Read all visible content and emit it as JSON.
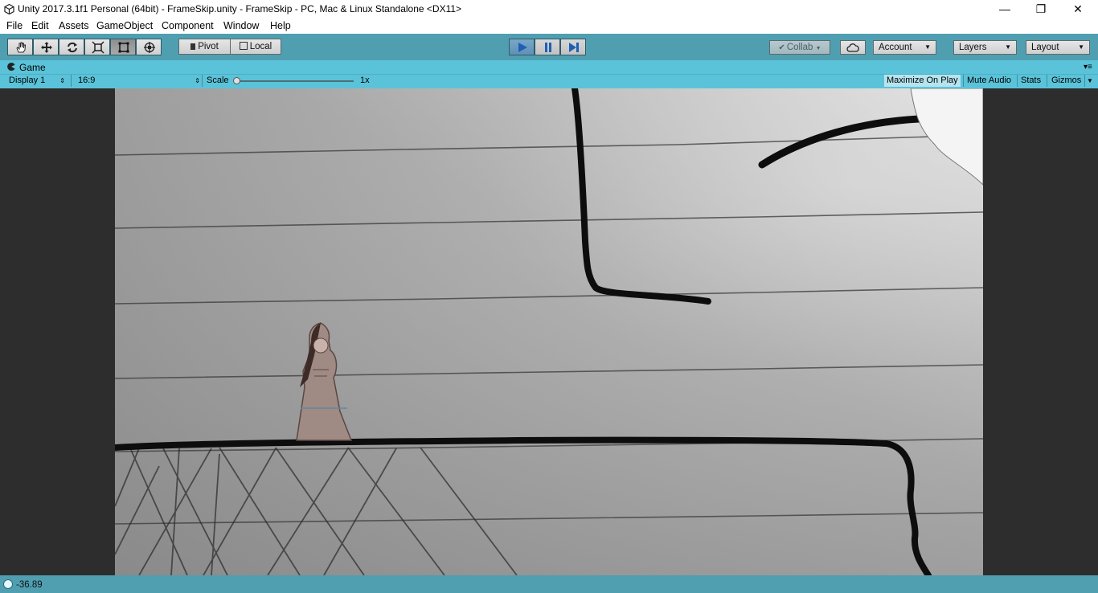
{
  "window": {
    "title": "Unity 2017.3.1f1 Personal (64bit) - FrameSkip.unity - FrameSkip - PC, Mac & Linux Standalone <DX11>",
    "minimize_glyph": "—",
    "maximize_glyph": "❐",
    "close_glyph": "✕"
  },
  "menu": {
    "items": [
      "File",
      "Edit",
      "Assets",
      "GameObject",
      "Component",
      "Window",
      "Help"
    ]
  },
  "toolbar": {
    "tools": [
      "hand-icon",
      "move-icon",
      "rotate-icon",
      "scale-icon",
      "rect-icon",
      "transform-icon"
    ],
    "active_tool": "rect-icon",
    "pivot_label": "Pivot",
    "local_label": "Local",
    "play_active": true,
    "collab_label": "Collab",
    "account_label": "Account",
    "layers_label": "Layers",
    "layout_label": "Layout",
    "dropdown_arrow": "▼"
  },
  "game_tab": {
    "label": "Game"
  },
  "game_bar": {
    "display_label": "Display 1",
    "aspect_label": "16:9",
    "scale_label": "Scale",
    "scale_value": "1x",
    "maximize_on_play": "Maximize On Play",
    "maximize_on_play_enabled": true,
    "mute_audio": "Mute Audio",
    "stats": "Stats",
    "gizmos": "Gizmos"
  },
  "status": {
    "text": "-36.89"
  },
  "colors": {
    "toolbar": "#4f9fb1",
    "tab_bar": "#5bc3d9",
    "viewport_bg": "#2d2d2d",
    "ink": "#111111"
  }
}
